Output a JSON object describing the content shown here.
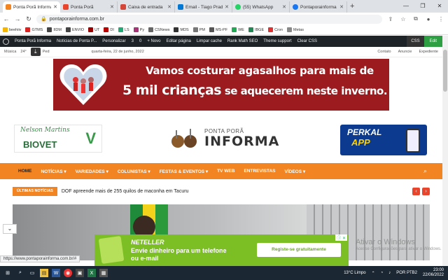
{
  "browser": {
    "tabs": [
      {
        "label": "Ponta Porã Informa",
        "color": "#f28522",
        "active": true
      },
      {
        "label": "Ponta Porã",
        "color": "#e8452c"
      },
      {
        "label": "Caixa de entrada",
        "color": "#d44638"
      },
      {
        "label": "Email - Tiago Prado",
        "color": "#0078d4"
      },
      {
        "label": "(55) WhatsApp",
        "color": "#25d366"
      },
      {
        "label": "Pontaporainforma",
        "color": "#1877f2"
      }
    ],
    "new_tab": "+",
    "url": "pontaporainforma.com.br",
    "window_controls": [
      "—",
      "❐",
      "✕"
    ]
  },
  "bookmarks": [
    {
      "label": "beehiiv",
      "color": "#f7b500"
    },
    {
      "label": "GTMS",
      "color": "#d22"
    },
    {
      "label": "IIDM",
      "color": "#444"
    },
    {
      "label": "ENVIO",
      "color": "#444"
    },
    {
      "label": "UT",
      "color": "#900"
    },
    {
      "label": "DI",
      "color": "#b00"
    },
    {
      "label": "LS",
      "color": "#2a7"
    },
    {
      "label": "Py",
      "color": "#a37"
    },
    {
      "label": "CSNews",
      "color": "#666"
    },
    {
      "label": "MDS",
      "color": "#333"
    },
    {
      "label": "PM",
      "color": "#777"
    },
    {
      "label": "MS-PF",
      "color": "#555"
    },
    {
      "label": "WE",
      "color": "#2a5"
    },
    {
      "label": "IBGE",
      "color": "#285"
    },
    {
      "label": "Cron",
      "color": "#d33"
    },
    {
      "label": "Metas",
      "color": "#888"
    }
  ],
  "wp_admin": {
    "items": [
      "Ponta Porã Informa",
      "Notícias de Ponta P...",
      "Personalizar",
      "3",
      "0",
      "+ Novo",
      "Editar página",
      "Limpar cache",
      "Rank Math SEO",
      "Theme support",
      "Clear CSS"
    ],
    "css": "CSS",
    "edit": "Edit"
  },
  "top": {
    "music": "Música",
    "temp": "24°",
    "share": "Ped",
    "date": "quarta-feira, 22 de junho, 2022",
    "links": [
      "Contato",
      "Anuncie",
      "Expediente"
    ]
  },
  "banner": {
    "line1": "Vamos costurar agasalhos para mais de",
    "line2_big": "5 mil crianças",
    "line2_rest": " se aquecerem  neste inverno."
  },
  "header": {
    "biovet_sig": "Nelson Martins",
    "biovet": "BIOVET",
    "logo_top": "PONTA PORÃ",
    "logo_main": "INFORMA",
    "perkal": "PERKAL",
    "perkal_app": "APP"
  },
  "nav": [
    "HOME",
    "NOTÍCIAS ▾",
    "VARIEDADES ▾",
    "COLUNISTAS ▾",
    "FESTAS & EVENTOS ▾",
    "TV WEB",
    "ENTREVISTAS",
    "VÍDEOS ▾"
  ],
  "ticker": {
    "label": "ÚLTIMAS NOTÍCIAS",
    "text": "DOF apreende mais de 255 quilos de maconha em Tacuru",
    "prev": "‹",
    "next": "›"
  },
  "status_url": "https://www.pontaporainforma.com.br/#",
  "ad": {
    "brand": "NETELLER",
    "text": "Envie dinheiro para um telefone ou e-mail",
    "cta": "Registe-se gratuitamente",
    "close": "ⓘ ✕"
  },
  "watermark": {
    "title": "Ativar o Windows",
    "sub": "Acesse Configurações para ativar o Windows."
  },
  "taskbar": {
    "weather": "13°C Limpo",
    "lang": "POR PTB2",
    "time": "23:00",
    "date": "22/06/2022"
  }
}
